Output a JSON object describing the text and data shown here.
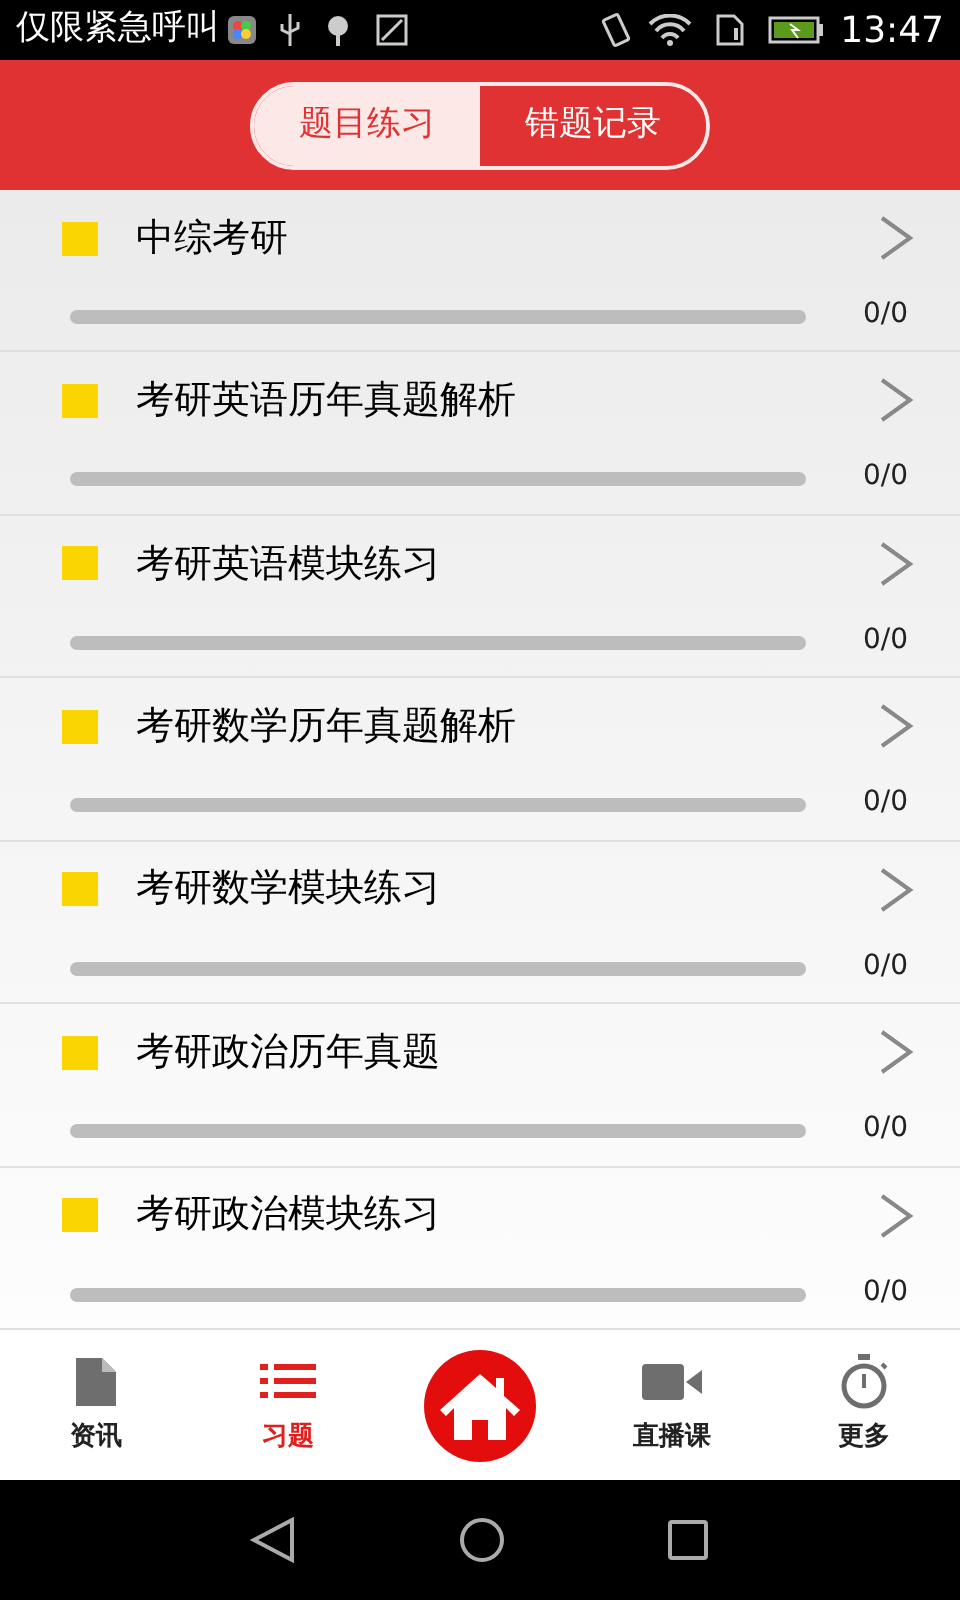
{
  "status_bar": {
    "carrier": "仅限紧急呼叫",
    "time": "13:47"
  },
  "tabs": [
    {
      "label": "题目练习",
      "selected": false
    },
    {
      "label": "错题记录",
      "selected": true
    }
  ],
  "subjects": [
    {
      "title": "中综考研",
      "count": "0/0"
    },
    {
      "title": "考研英语历年真题解析",
      "count": "0/0"
    },
    {
      "title": "考研英语模块练习",
      "count": "0/0"
    },
    {
      "title": "考研数学历年真题解析",
      "count": "0/0"
    },
    {
      "title": "考研数学模块练习",
      "count": "0/0"
    },
    {
      "title": "考研政治历年真题",
      "count": "0/0"
    },
    {
      "title": "考研政治模块练习",
      "count": "0/0"
    }
  ],
  "bottom_nav": [
    {
      "kind": "doc",
      "label": "资讯",
      "selected": false
    },
    {
      "kind": "list",
      "label": "习题",
      "selected": true
    },
    {
      "kind": "home",
      "selected": false
    },
    {
      "kind": "video",
      "label": "直播课",
      "selected": false
    },
    {
      "kind": "timer",
      "label": "更多",
      "selected": false
    }
  ]
}
